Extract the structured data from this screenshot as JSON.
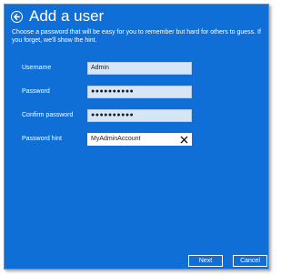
{
  "dialog": {
    "title": "Add a user",
    "description": "Choose a password that will be easy for you to remember but hard for others to guess. If you forget, we'll show the hint."
  },
  "fields": {
    "username": {
      "label": "Username",
      "value": "Admin"
    },
    "password": {
      "label": "Password",
      "value": "●●●●●●●●●●"
    },
    "confirm_password": {
      "label": "Confirm password",
      "value": "●●●●●●●●●●"
    },
    "password_hint": {
      "label": "Password hint",
      "value": "MyAdminAccount"
    }
  },
  "buttons": {
    "next": "Next",
    "cancel": "Cancel"
  },
  "icons": {
    "back": "back-arrow-icon",
    "clear": "clear-x-icon"
  },
  "colors": {
    "background": "#0f6fd6",
    "input_background": "#d7e6f6",
    "active_input_background": "#ffffff",
    "text": "#ffffff"
  }
}
